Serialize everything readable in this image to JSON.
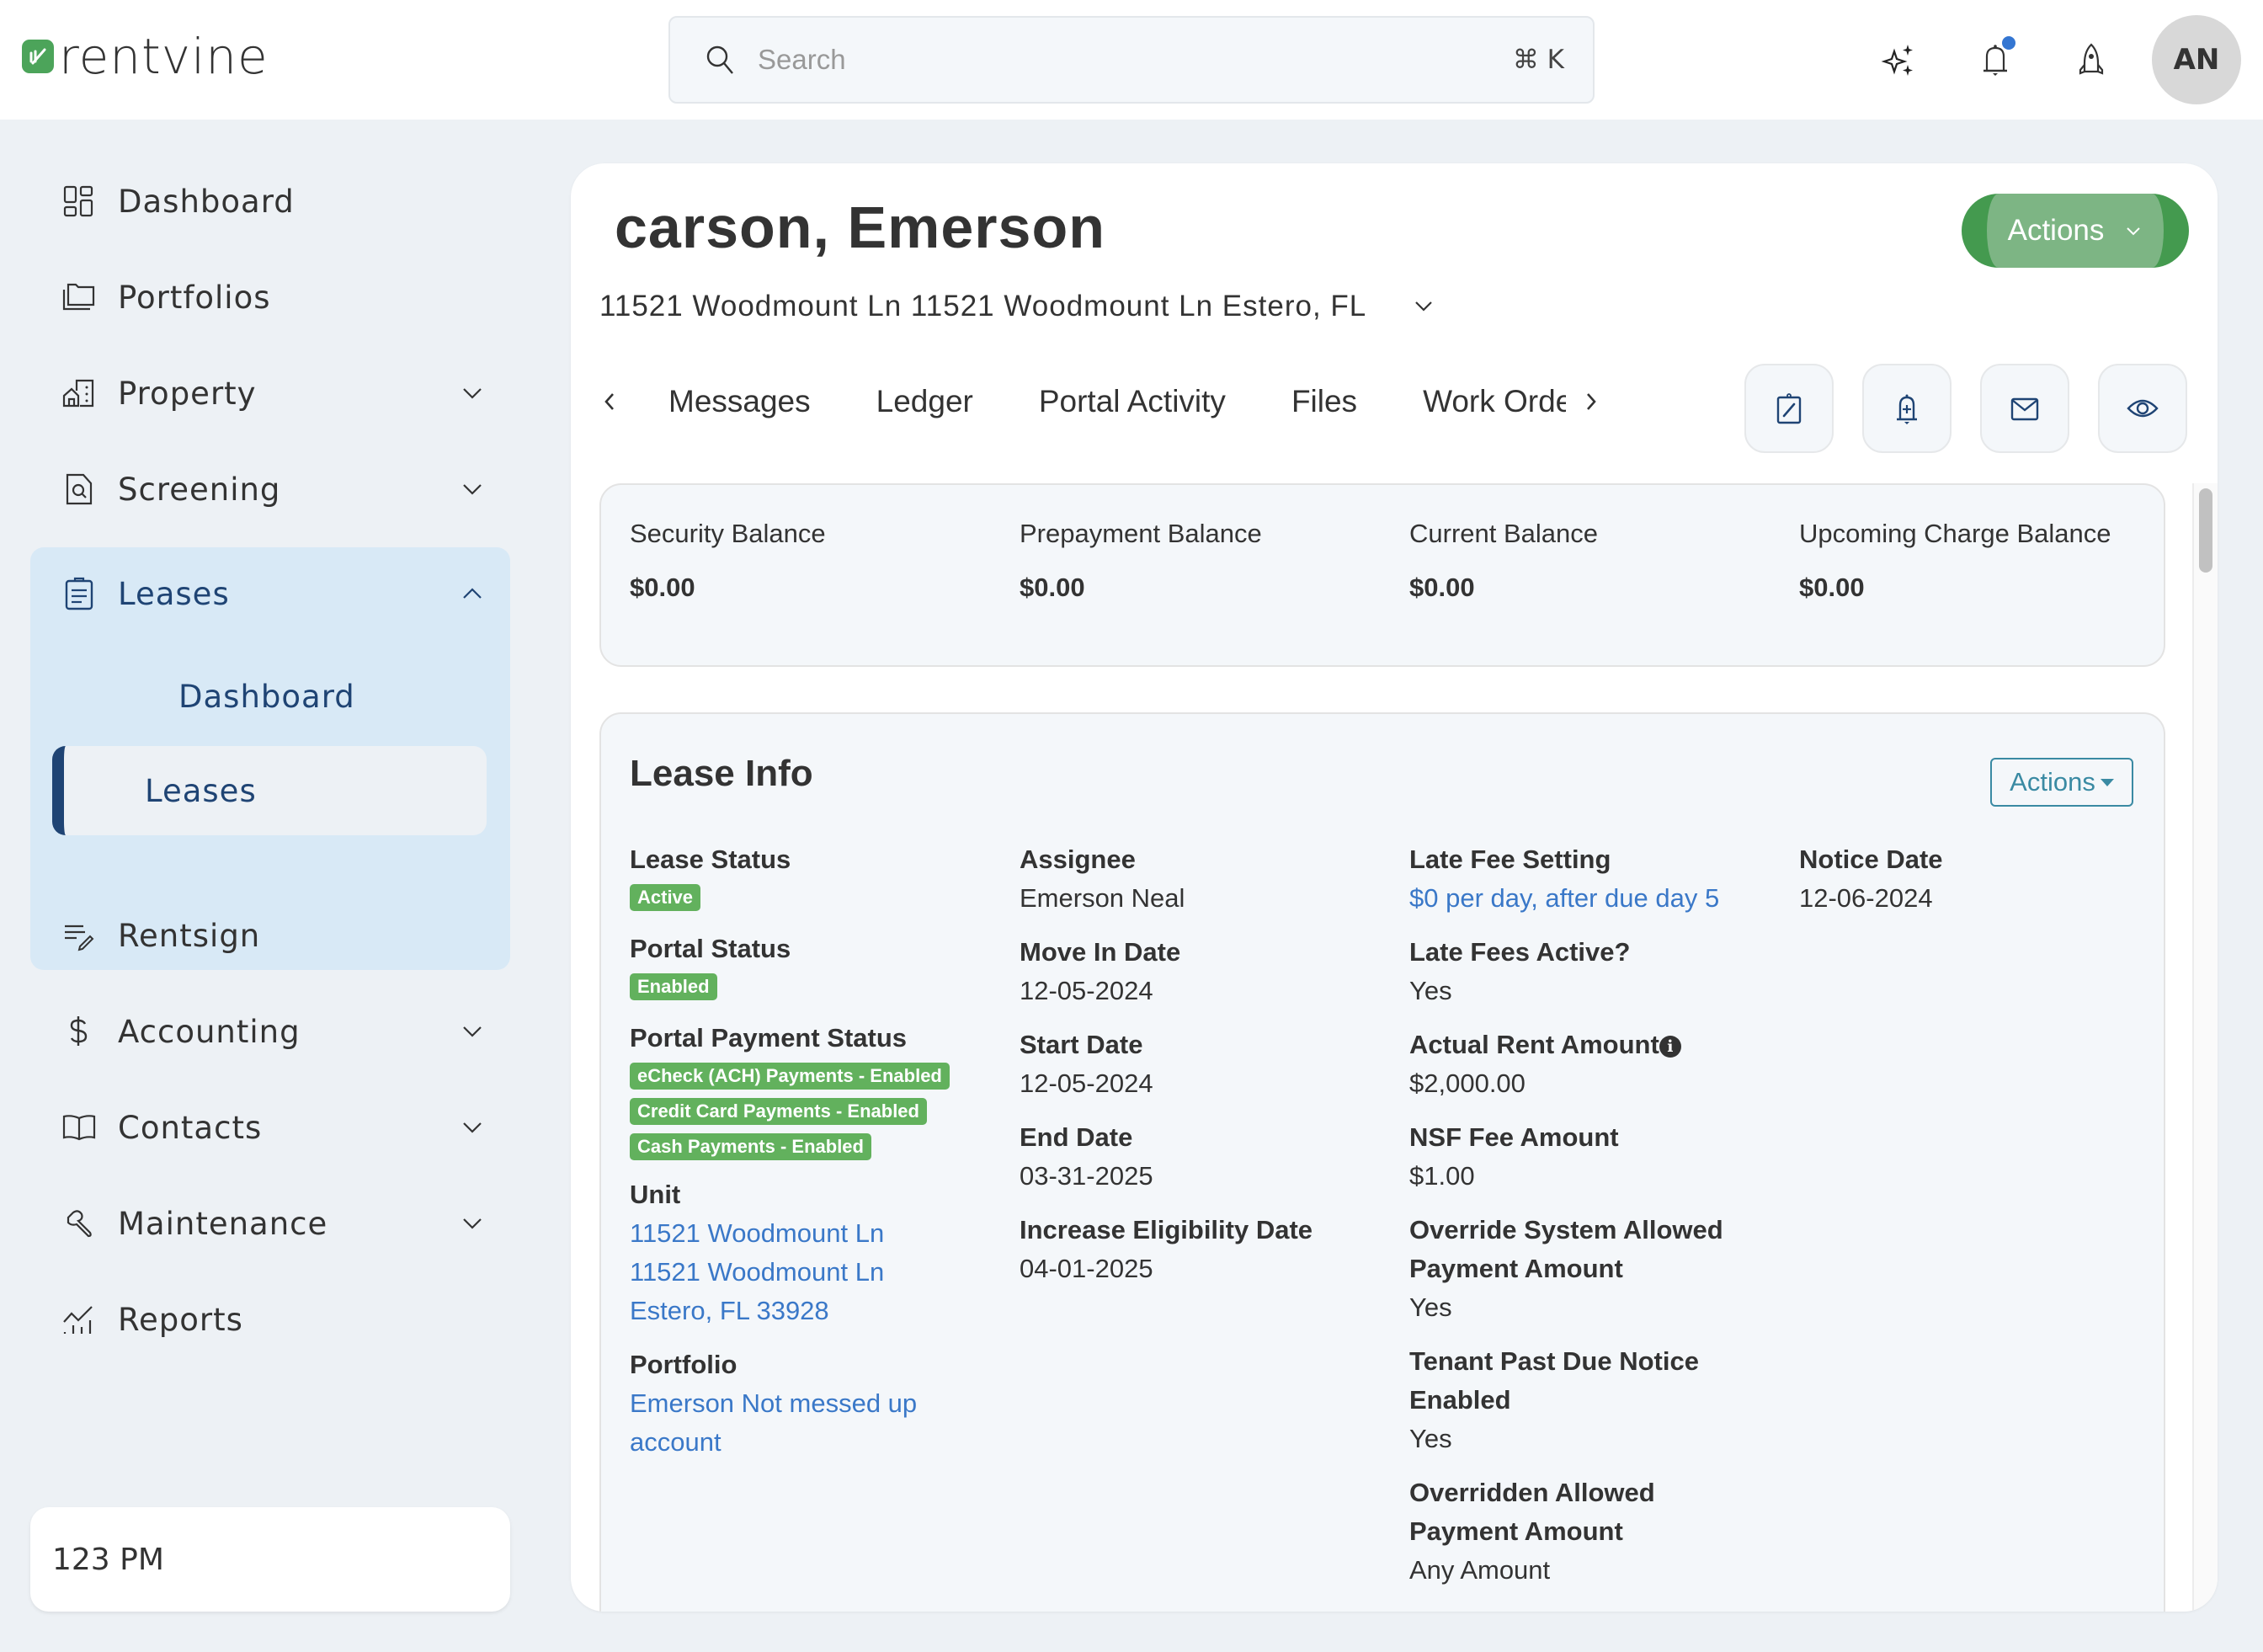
{
  "app": {
    "brand": "rentvine",
    "search": {
      "placeholder": "Search",
      "value": "",
      "shortcut": "⌘ K"
    },
    "header_icons": [
      "sparkles-icon",
      "bell-icon",
      "rocket-icon"
    ],
    "notification_dot_color": "#3476d2",
    "avatar_initials": "AN"
  },
  "sidebar": {
    "items": [
      {
        "label": "Dashboard",
        "icon": "dashboard-grid-icon",
        "expandable": false
      },
      {
        "label": "Portfolios",
        "icon": "folders-icon",
        "expandable": false
      },
      {
        "label": "Property",
        "icon": "property-building-icon",
        "expandable": true
      },
      {
        "label": "Screening",
        "icon": "screening-search-doc-icon",
        "expandable": true
      },
      {
        "label": "Leases",
        "icon": "clipboard-icon",
        "expandable": true,
        "expanded": true,
        "children": [
          {
            "label": "Dashboard",
            "active": false
          },
          {
            "label": "Leases",
            "active": true
          }
        ]
      },
      {
        "label": "Rentsign",
        "icon": "rentsign-pen-icon",
        "expandable": false
      },
      {
        "label": "Accounting",
        "icon": "dollar-icon",
        "expandable": true
      },
      {
        "label": "Contacts",
        "icon": "book-icon",
        "expandable": true
      },
      {
        "label": "Maintenance",
        "icon": "wrench-icon",
        "expandable": true
      },
      {
        "label": "Reports",
        "icon": "reports-chart-icon",
        "expandable": false
      }
    ],
    "clock": "123 PM"
  },
  "lease": {
    "tenant_name": "carson, Emerson",
    "actions_label": "Actions",
    "address": "11521 Woodmount Ln 11521 Woodmount Ln Estero, FL",
    "tabs": [
      "Messages",
      "Ledger",
      "Portal Activity",
      "Files",
      "Work Orders"
    ],
    "icon_buttons": [
      "edit-clipboard-icon",
      "add-reminder-bell-icon",
      "email-icon",
      "view-eye-icon"
    ],
    "balances": [
      {
        "label": "Security Balance",
        "value": "$0.00"
      },
      {
        "label": "Prepayment Balance",
        "value": "$0.00"
      },
      {
        "label": "Current Balance",
        "value": "$0.00"
      },
      {
        "label": "Upcoming Charge Balance",
        "value": "$0.00"
      }
    ],
    "info": {
      "title": "Lease Info",
      "actions_label": "Actions",
      "lease_status_label": "Lease Status",
      "lease_status": "Active",
      "portal_status_label": "Portal Status",
      "portal_status": "Enabled",
      "portal_payment_status_label": "Portal Payment Status",
      "portal_payment_badges": [
        "eCheck (ACH) Payments - Enabled",
        "Credit Card Payments - Enabled",
        "Cash Payments - Enabled"
      ],
      "unit_label": "Unit",
      "unit_lines": [
        "11521 Woodmount Ln",
        "11521 Woodmount Ln",
        "Estero, FL 33928"
      ],
      "portfolio_label": "Portfolio",
      "portfolio": "Emerson Not messed up account",
      "assignee_label": "Assignee",
      "assignee": "Emerson Neal",
      "move_in_label": "Move In Date",
      "move_in": "12-05-2024",
      "start_label": "Start Date",
      "start": "12-05-2024",
      "end_label": "End Date",
      "end": "03-31-2025",
      "increase_label": "Increase Eligibility Date",
      "increase": "04-01-2025",
      "late_fee_setting_label": "Late Fee Setting",
      "late_fee_setting": "$0 per day, after due day 5",
      "late_fees_active_label": "Late Fees Active?",
      "late_fees_active": "Yes",
      "actual_rent_label": "Actual Rent Amount",
      "actual_rent": "$2,000.00",
      "nsf_label": "NSF Fee Amount",
      "nsf": "$1.00",
      "override_label": "Override System Allowed Payment Amount",
      "override": "Yes",
      "past_due_label": "Tenant Past Due Notice Enabled",
      "past_due": "Yes",
      "overridden_label": "Overridden Allowed Payment Amount",
      "overridden": "Any Amount",
      "notice_date_label": "Notice Date",
      "notice_date": "12-06-2024"
    }
  },
  "colors": {
    "brand_green": "#4ca45a",
    "nav_active": "#1f4474",
    "badge_green": "#62b15d",
    "link_blue": "#3a78c8"
  }
}
